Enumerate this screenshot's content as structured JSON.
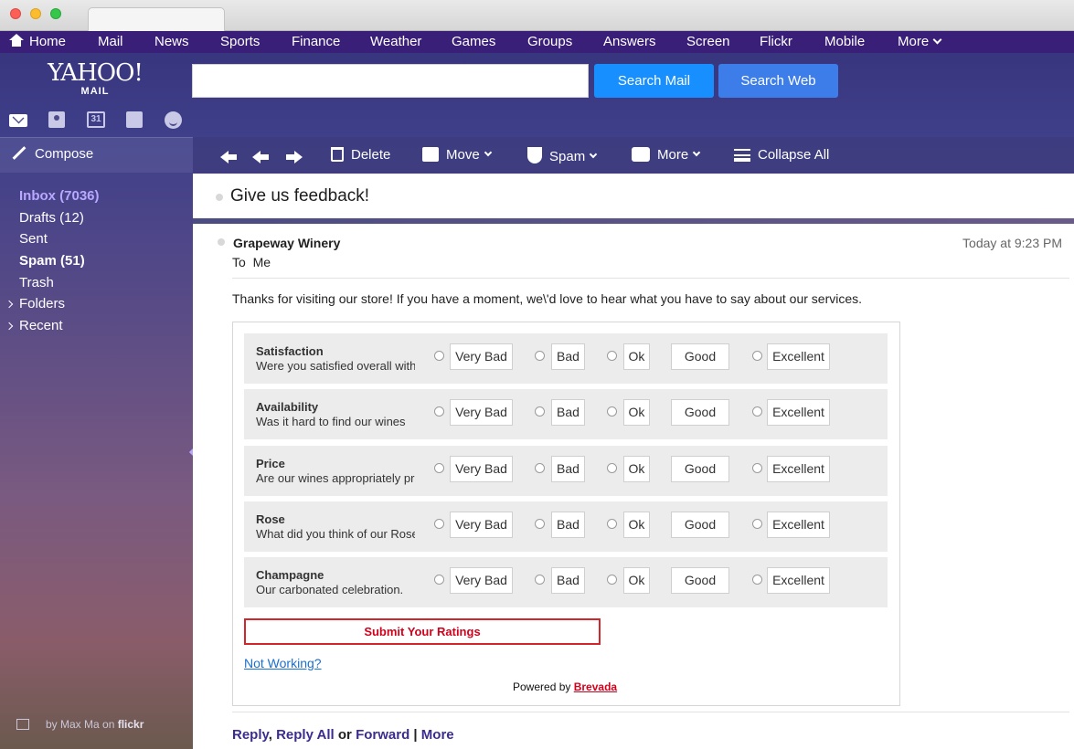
{
  "nav": {
    "items": [
      "Home",
      "Mail",
      "News",
      "Sports",
      "Finance",
      "Weather",
      "Games",
      "Groups",
      "Answers",
      "Screen",
      "Flickr",
      "Mobile",
      "More"
    ]
  },
  "header": {
    "logo_main": "YAHOO!",
    "logo_sub": "MAIL",
    "search_value": "",
    "search_mail_label": "Search Mail",
    "search_web_label": "Search Web",
    "calendar_day": "31"
  },
  "sidebar": {
    "compose_label": "Compose",
    "folders": [
      "Inbox (7036)",
      "Drafts (12)",
      "Sent",
      "Spam (51)",
      "Trash",
      "Folders",
      "Recent"
    ],
    "credit_prefix": "by Max Ma on",
    "credit_source": "flickr"
  },
  "toolbar": {
    "delete_label": "Delete",
    "move_label": "Move",
    "spam_label": "Spam",
    "more_label": "More",
    "collapse_label": "Collapse All"
  },
  "message": {
    "subject": "Give us feedback!",
    "from": "Grapeway Winery",
    "to_label": "To",
    "to_value": "Me",
    "time": "Today at 9:23 PM",
    "intro": "Thanks for visiting our store! If you have a moment, we\\'d love to hear what you have to say about our services."
  },
  "survey": {
    "options": [
      "Very Bad",
      "Bad",
      "Ok",
      "Good",
      "Excellent"
    ],
    "questions": [
      {
        "title": "Satisfaction",
        "desc": "Were you satisfied overall with"
      },
      {
        "title": "Availability",
        "desc": "Was it hard to find our wines"
      },
      {
        "title": "Price",
        "desc": "Are our wines appropriately priced"
      },
      {
        "title": "Rose",
        "desc": "What did you think of our Rose"
      },
      {
        "title": "Champagne",
        "desc": "Our carbonated celebration."
      }
    ],
    "submit_label": "Submit Your Ratings",
    "not_working_label": "Not Working?",
    "powered_prefix": "Powered by",
    "powered_brand": "Brevada"
  },
  "footer": {
    "reply": "Reply",
    "reply_all": "Reply All",
    "or": "or",
    "forward": "Forward",
    "sep": "|",
    "more": "More"
  }
}
